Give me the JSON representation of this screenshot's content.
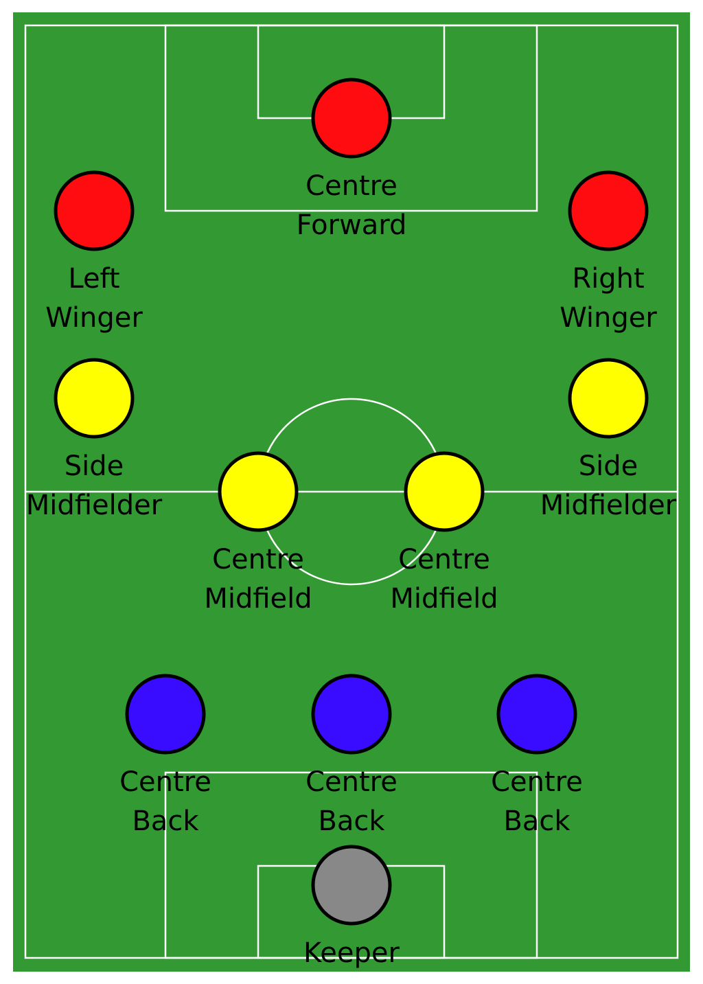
{
  "colors": {
    "pitch": "#339933",
    "lines": "#ffffff",
    "forward": "#ff0c10",
    "midfield": "#ffff00",
    "defence": "#3a0cff",
    "keeper": "#888888",
    "outline": "#000000"
  },
  "players": [
    {
      "role": "forward",
      "line1": "Centre",
      "line2": "Forward"
    },
    {
      "role": "forward",
      "line1": "Left",
      "line2": "Winger"
    },
    {
      "role": "forward",
      "line1": "Right",
      "line2": "Winger"
    },
    {
      "role": "midfield",
      "line1": "Side",
      "line2": "Midfielder"
    },
    {
      "role": "midfield",
      "line1": "Side",
      "line2": "Midfielder"
    },
    {
      "role": "midfield",
      "line1": "Centre",
      "line2": "Midfield"
    },
    {
      "role": "midfield",
      "line1": "Centre",
      "line2": "Midfield"
    },
    {
      "role": "defence",
      "line1": "Centre",
      "line2": "Back"
    },
    {
      "role": "defence",
      "line1": "Centre",
      "line2": "Back"
    },
    {
      "role": "defence",
      "line1": "Centre",
      "line2": "Back"
    },
    {
      "role": "keeper",
      "line1": "Keeper",
      "line2": ""
    }
  ]
}
